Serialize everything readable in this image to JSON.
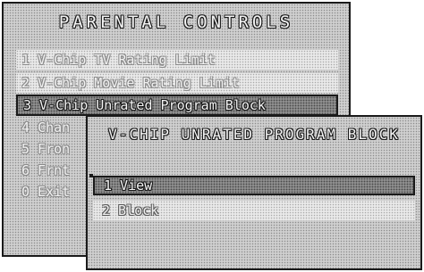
{
  "main_menu": {
    "title": "PARENTAL CONTROLS",
    "items": [
      {
        "label": "1 V-Chip TV Rating Limit",
        "state": "dim"
      },
      {
        "label": "2 V-Chip Movie Rating Limit",
        "state": "dim"
      },
      {
        "label": "3 V-Chip Unrated Program Block",
        "state": "selected"
      },
      {
        "label": "4 Chan",
        "state": "dim"
      },
      {
        "label": "5 Fron",
        "state": "dim"
      },
      {
        "label": "6 Frnt",
        "state": "dim"
      },
      {
        "label": "0 Exit",
        "state": "dim"
      }
    ]
  },
  "submenu": {
    "title": "V-CHIP UNRATED PROGRAM BLOCK",
    "items": [
      {
        "label": "1 View",
        "state": "selected"
      },
      {
        "label": "2 Block",
        "state": "dim"
      }
    ]
  },
  "colors": {
    "panel_fill": "#cfcfcf",
    "outline": "#1a1a1a",
    "highlight_fill": "#8e8e8e",
    "text_fill": "#f4f4f4"
  }
}
